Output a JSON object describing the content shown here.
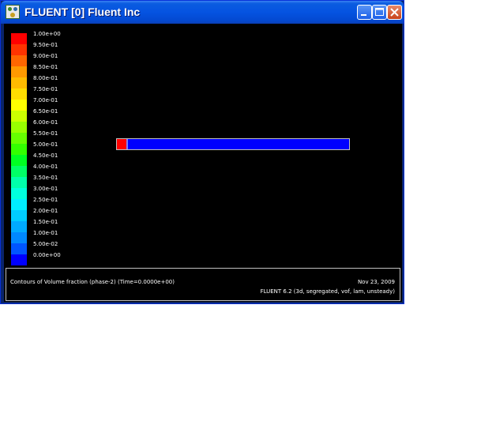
{
  "window": {
    "title": "FLUENT [0] Fluent Inc",
    "icon": "fluent-app-icon",
    "controls": [
      "minimize-icon",
      "maximize-icon",
      "close-icon"
    ]
  },
  "legend": {
    "items": [
      {
        "label": "1.00e+00",
        "color": "#ff0000"
      },
      {
        "label": "9.50e-01",
        "color": "#ff3300"
      },
      {
        "label": "9.00e-01",
        "color": "#ff6600"
      },
      {
        "label": "8.50e-01",
        "color": "#ff9900"
      },
      {
        "label": "8.00e-01",
        "color": "#ffbb00"
      },
      {
        "label": "7.50e-01",
        "color": "#ffdd00"
      },
      {
        "label": "7.00e-01",
        "color": "#ffff00"
      },
      {
        "label": "6.50e-01",
        "color": "#ccff00"
      },
      {
        "label": "6.00e-01",
        "color": "#99ff00"
      },
      {
        "label": "5.50e-01",
        "color": "#66ff00"
      },
      {
        "label": "5.00e-01",
        "color": "#33ff00"
      },
      {
        "label": "4.50e-01",
        "color": "#00ff22"
      },
      {
        "label": "4.00e-01",
        "color": "#00ff66"
      },
      {
        "label": "3.50e-01",
        "color": "#00ffaa"
      },
      {
        "label": "3.00e-01",
        "color": "#00ffdd"
      },
      {
        "label": "2.50e-01",
        "color": "#00eeff"
      },
      {
        "label": "2.00e-01",
        "color": "#00ccff"
      },
      {
        "label": "1.50e-01",
        "color": "#00aaff"
      },
      {
        "label": "1.00e-01",
        "color": "#0088ff"
      },
      {
        "label": "5.00e-02",
        "color": "#0055ff"
      },
      {
        "label": "0.00e+00",
        "color": "#0000ff"
      }
    ]
  },
  "domain": {
    "fill_color": "#0000ff",
    "inlet_color": "#ff0000"
  },
  "caption": {
    "description": "Contours of Volume fraction (phase-2)  (Time=0.0000e+00)",
    "date": "Nov 23, 2009",
    "version": "FLUENT 6.2 (3d, segregated, vof, lam, unsteady)"
  }
}
